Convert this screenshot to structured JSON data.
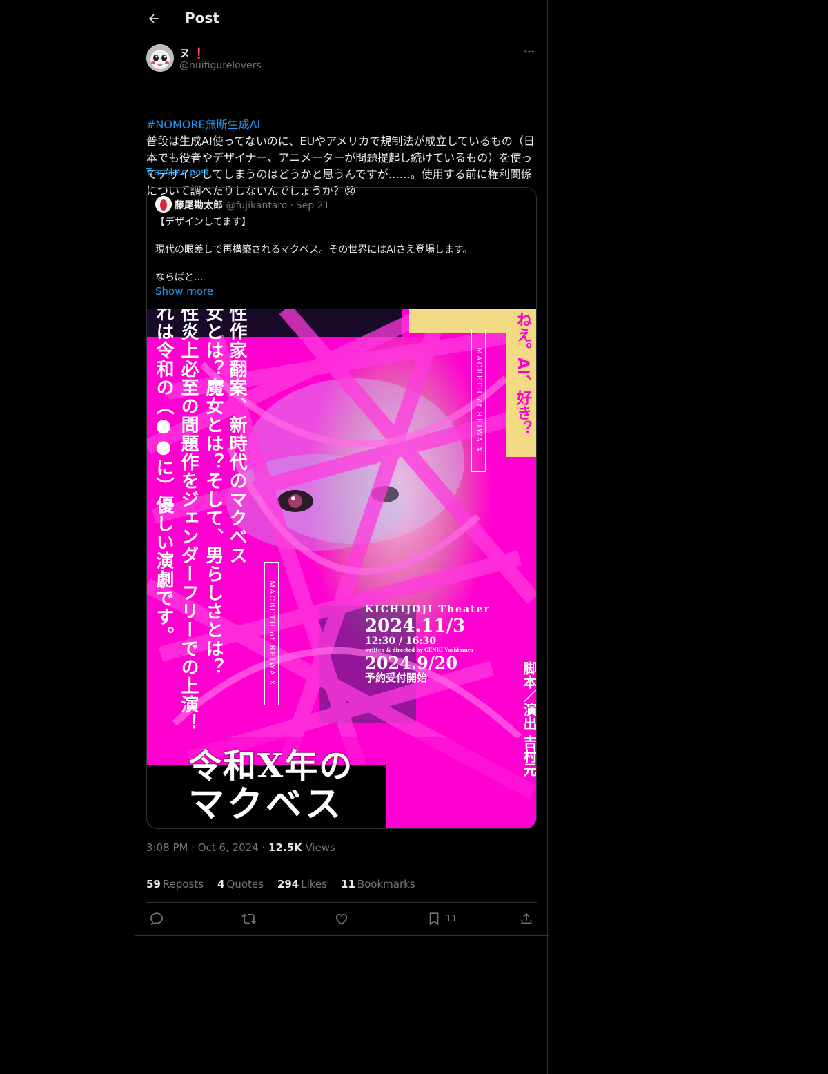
{
  "header": {
    "title": "Post"
  },
  "post": {
    "author_name": "ヌ",
    "author_badge": "❗",
    "author_handle": "@nuifigurelovers",
    "hashtag": "#NOMORE無断生成AI",
    "body": "普段は生成AI使ってないのに、EUやアメリカで規制法が成立しているもの（日本でも役者やデザイナー、アニメーターが問題提起し続けているもの）を使ってデザインしてしまうのはどうかと思うんですが……。使用する前に権利関係について調べたりしないんでしょうか？",
    "emoji": "😢",
    "translate_label": "Translate post",
    "time": "3:08 PM",
    "date": "Oct 6, 2024",
    "views_count": "12.5K",
    "views_label": "Views"
  },
  "quote": {
    "name": "藤尾勘太郎",
    "handle": "@fujikantaro",
    "date": "Sep 21",
    "line1": "【デザインしてます】",
    "line2": "現代の眼差しで再構築されるマクベス。その世界にはAIさえ登場します。",
    "line3": "ならばと...",
    "show_more": "Show more"
  },
  "poster": {
    "title_line1": "令和X年の",
    "title_line2": "マクベス",
    "vertical_col1": "性作家翻案、新時代のマクベス",
    "vertical_col2": "女とは？魔女とは？そして、男らしさとは？",
    "vertical_col3": "性炎上必至の問題作をジェンダーフリーでの上演！",
    "vertical_col4": "れは令和の（●●に）優しい演劇です。",
    "ai_text": "ねえ。AI、好き？",
    "macbeth_label": "MACBETH of REIWA X",
    "theater": "KICHIJOJI Theater",
    "date1": "2024.11/3",
    "times": "12:30 / 16:30",
    "credits": "written & directed by GENKI Yoshimura",
    "date2": "2024.9/20",
    "reservation": "予約受付開始",
    "side_credit": "脚本／演出 吉村元"
  },
  "stats": {
    "reposts": "59",
    "reposts_label": "Reposts",
    "quotes": "4",
    "quotes_label": "Quotes",
    "likes": "294",
    "likes_label": "Likes",
    "bookmarks": "11",
    "bookmarks_label": "Bookmarks"
  },
  "actions": {
    "bookmark_count": "11"
  },
  "colors": {
    "accent": "#1d9bf0",
    "poster_pink": "#ff00d0",
    "poster_yellow": "#f2d983"
  }
}
